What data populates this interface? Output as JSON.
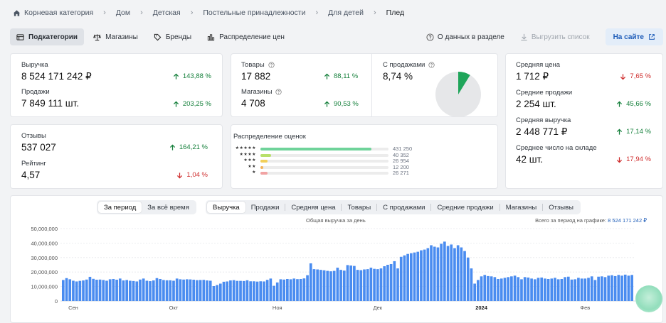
{
  "breadcrumb": {
    "items": [
      "Корневая категория",
      "Дом",
      "Детская",
      "Постельные принадлежности",
      "Для детей",
      "Плед"
    ]
  },
  "tabs": [
    {
      "label": "Подкатегории",
      "icon": "table-icon",
      "active": true
    },
    {
      "label": "Магазины",
      "icon": "scales-icon",
      "active": false
    },
    {
      "label": "Бренды",
      "icon": "tag-icon",
      "active": false
    },
    {
      "label": "Распределение цен",
      "icon": "bar-chart-icon",
      "active": false
    }
  ],
  "toolbar": {
    "info_label": "О данных в разделе",
    "export_label": "Выгрузить список",
    "site_label": "На сайте"
  },
  "metrics": {
    "revenue": {
      "label": "Выручка",
      "value": "8 524 171 242 ₽",
      "delta": "143,88 %",
      "trend": "up"
    },
    "sales": {
      "label": "Продажи",
      "value": "7 849 111 шт.",
      "delta": "203,25 %",
      "trend": "up"
    },
    "products": {
      "label": "Товары",
      "value": "17 882",
      "delta": "88,11 %",
      "trend": "up"
    },
    "shops": {
      "label": "Магазины",
      "value": "4 708",
      "delta": "90,53 %",
      "trend": "up"
    },
    "with_sales": {
      "label": "С продажами",
      "value": "8,74 %",
      "fraction": 0.0874
    },
    "reviews": {
      "label": "Отзывы",
      "value": "537 027",
      "delta": "164,21 %",
      "trend": "up"
    },
    "rating": {
      "label": "Рейтинг",
      "value": "4,57",
      "delta": "1,04 %",
      "trend": "down"
    },
    "avg_price": {
      "label": "Средняя цена",
      "value": "1 712 ₽",
      "delta": "7,65 %",
      "trend": "down"
    },
    "avg_sales": {
      "label": "Средние продажи",
      "value": "2 254 шт.",
      "delta": "45,66 %",
      "trend": "up"
    },
    "avg_revenue": {
      "label": "Средняя выручка",
      "value": "2 448 771 ₽",
      "delta": "17,14 %",
      "trend": "up"
    },
    "avg_stock": {
      "label": "Среднее число на складе",
      "value": "42 шт.",
      "delta": "17,94 %",
      "trend": "down"
    }
  },
  "ratings": {
    "title": "Распределение оценок",
    "rows": [
      {
        "stars": "★★★★★",
        "count": "431 250",
        "value": 431250,
        "color": "#6fd39a"
      },
      {
        "stars": "★★★★",
        "count": "40 352",
        "value": 40352,
        "color": "#b8e06a"
      },
      {
        "stars": "★★★",
        "count": "26 954",
        "value": 26954,
        "color": "#f2d05a"
      },
      {
        "stars": "★★",
        "count": "12 200",
        "value": 12200,
        "color": "#f4b35a"
      },
      {
        "stars": "★",
        "count": "26 271",
        "value": 26271,
        "color": "#f1a3a3"
      }
    ]
  },
  "period_toggle": {
    "options": [
      "За период",
      "За всё время"
    ],
    "active": 0
  },
  "metric_toggle": {
    "options": [
      "Выручка",
      "Продажи",
      "Средняя цена",
      "Товары",
      "С продажами",
      "Средние продажи",
      "Магазины",
      "Отзывы"
    ],
    "active": 0
  },
  "chart_head": {
    "title": "Общая выручка за день",
    "total_label": "Всего за период на графике:",
    "total_value": "8 524 171 242 ₽"
  },
  "colors": {
    "accent": "#1c5bb8",
    "bar": "#4a8cf0",
    "up": "#16803c",
    "down": "#cf2e2e",
    "pie_fill": "#1fa55a",
    "pie_bg": "#e6e7e9"
  },
  "chart_data": {
    "type": "bar",
    "title": "Общая выручка за день",
    "ylim": [
      0,
      50000000
    ],
    "y_ticks": [
      "0",
      "10,000,000",
      "20,000,000",
      "30,000,000",
      "40,000,000",
      "50,000,000"
    ],
    "y_tick_values": [
      0,
      10000000,
      20000000,
      30000000,
      40000000,
      50000000
    ],
    "x_tick_labels": [
      {
        "label": "Сен",
        "index": 3,
        "bold": false
      },
      {
        "label": "Окт",
        "index": 33,
        "bold": false
      },
      {
        "label": "Ноя",
        "index": 64,
        "bold": false
      },
      {
        "label": "Дек",
        "index": 94,
        "bold": false
      },
      {
        "label": "2024",
        "index": 125,
        "bold": true
      },
      {
        "label": "Фев",
        "index": 156,
        "bold": false
      }
    ],
    "grid": true,
    "series": [
      {
        "values": [
          14.5,
          15.8,
          15.0,
          14.0,
          13.5,
          13.9,
          14.2,
          14.8,
          16.7,
          15.3,
          14.7,
          14.8,
          14.5,
          14.0,
          15.0,
          15.2,
          14.7,
          15.5,
          14.2,
          14.5,
          14.0,
          13.8,
          13.5,
          14.8,
          15.5,
          14.0,
          13.7,
          14.2,
          15.8,
          15.2,
          14.5,
          14.3,
          14.3,
          14.0,
          15.5,
          15.0,
          14.8,
          15.0,
          14.9,
          14.7,
          14.4,
          14.5,
          14.6,
          14.2,
          14.0,
          10.3,
          11.0,
          12.0,
          13.3,
          13.5,
          14.2,
          14.4,
          13.9,
          13.9,
          13.8,
          14.3,
          13.6,
          13.6,
          13.4,
          13.6,
          13.5,
          14.6,
          15.5,
          10.5,
          12.8,
          15.0,
          14.8,
          15.2,
          15.0,
          15.5,
          15.1,
          15.2,
          15.6,
          17.8,
          26.0,
          22.0,
          21.8,
          21.5,
          21.2,
          20.8,
          20.5,
          20.8,
          23.0,
          21.5,
          21.0,
          24.8,
          24.5,
          24.2,
          21.5,
          21.3,
          21.8,
          22.0,
          23.0,
          22.2,
          22.0,
          22.5,
          24.0,
          25.0,
          25.5,
          27.5,
          22.5,
          30.5,
          31.5,
          32.5,
          33.0,
          33.5,
          34.0,
          35.0,
          35.5,
          36.5,
          38.5,
          37.5,
          37.0,
          39.5,
          41.0,
          38.0,
          39.0,
          36.5,
          38.5,
          37.0,
          34.5,
          30.0,
          22.5,
          12.0,
          14.5,
          17.0,
          18.0,
          17.2,
          17.0,
          16.5,
          15.2,
          15.5,
          16.0,
          16.5,
          17.0,
          17.5,
          16.5,
          15.0,
          16.5,
          16.2,
          15.5,
          15.0,
          16.0,
          16.2,
          15.5,
          15.2,
          15.5,
          16.0,
          15.0,
          15.2,
          16.5,
          16.8,
          14.8,
          15.0,
          16.0,
          15.5,
          15.5,
          16.0,
          17.0,
          14.5,
          16.8,
          17.0,
          16.5,
          17.5,
          17.8,
          17.2,
          18.0,
          17.5,
          18.2,
          17.5,
          18.0
        ]
      }
    ]
  }
}
